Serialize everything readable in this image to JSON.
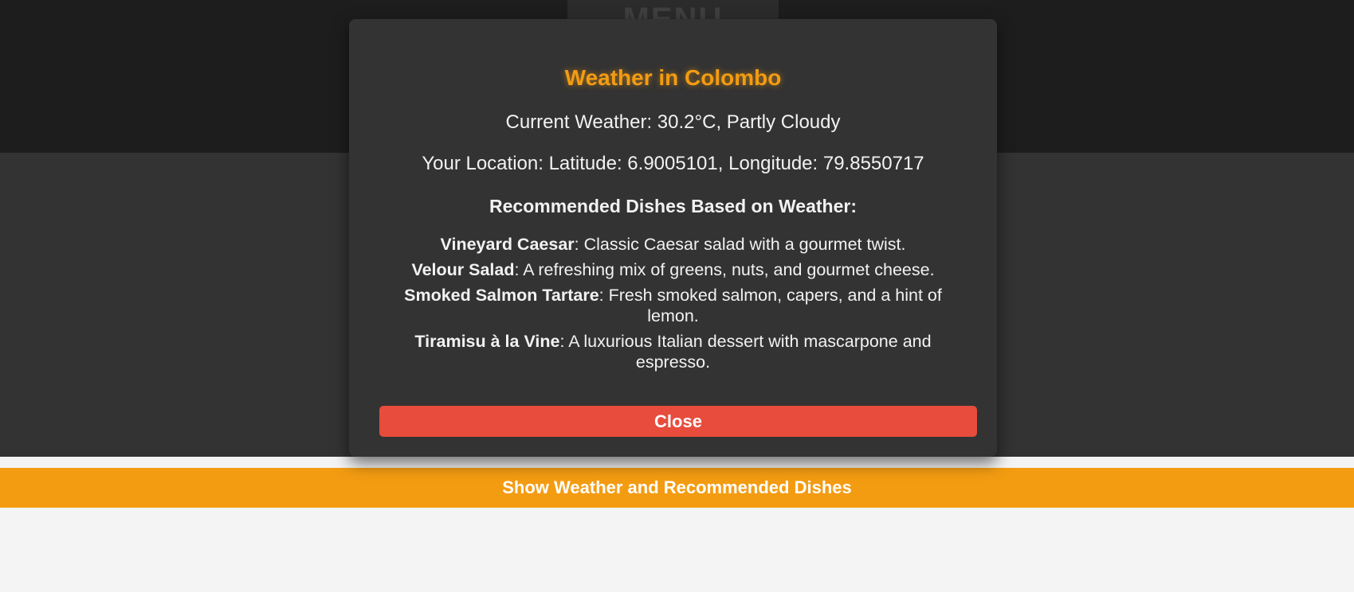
{
  "header": {
    "menu_label": "MENU"
  },
  "actions": {
    "show_weather_label": "Show Weather and Recommended Dishes"
  },
  "modal": {
    "title": "Weather in Colombo",
    "current_weather": "Current Weather: 30.2°C, Partly Cloudy",
    "location": "Your Location: Latitude: 6.9005101, Longitude: 79.8550717",
    "recommend_heading": "Recommended Dishes Based on Weather:",
    "dishes": [
      {
        "name": "Vineyard Caesar",
        "description": ": Classic Caesar salad with a gourmet twist."
      },
      {
        "name": "Velour Salad",
        "description": ": A refreshing mix of greens, nuts, and gourmet cheese."
      },
      {
        "name": "Smoked Salmon Tartare",
        "description": ": Fresh smoked salmon, capers, and a hint of lemon."
      },
      {
        "name": "Tiramisu à la Vine",
        "description": ": A luxurious Italian dessert with mascarpone and espresso."
      }
    ],
    "close_label": "Close"
  },
  "colors": {
    "accent": "#f39c12",
    "danger": "#e74c3c",
    "panel": "#333333",
    "header": "#1d1d1d",
    "page_bg": "#f4f4f4"
  }
}
